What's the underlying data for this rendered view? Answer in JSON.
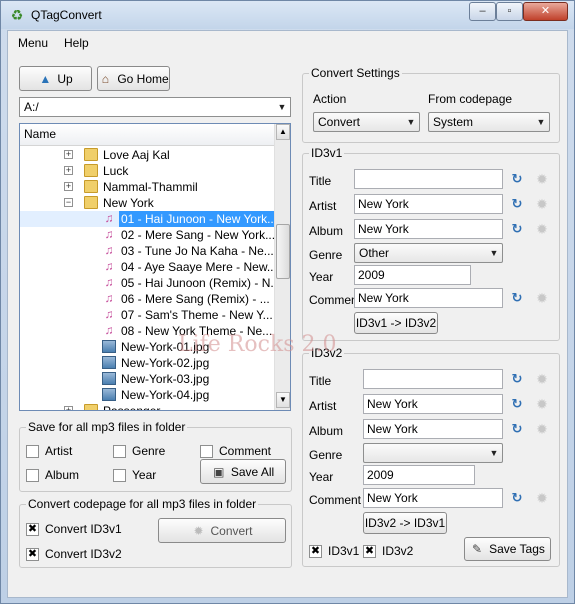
{
  "window": {
    "title": "QTagConvert",
    "min": "–",
    "max": "▫",
    "close": "✕"
  },
  "menu": [
    "Menu",
    "Help"
  ],
  "nav": {
    "up_label": "Up",
    "go_home_label": "Go Home",
    "path": "A:/"
  },
  "tree": {
    "header": "Name",
    "rows": [
      {
        "label": "Love Aaj Kal",
        "type": "folder"
      },
      {
        "label": "Luck",
        "type": "folder"
      },
      {
        "label": "Nammal-Thammil",
        "type": "folder"
      },
      {
        "label": "New York",
        "type": "folder"
      },
      {
        "label": "01 - Hai Junoon - New York...",
        "type": "music"
      },
      {
        "label": "02 - Mere Sang - New York...",
        "type": "music"
      },
      {
        "label": "03 - Tune Jo Na Kaha - Ne...",
        "type": "music"
      },
      {
        "label": "04 - Aye Saaye Mere - New...",
        "type": "music"
      },
      {
        "label": "05 - Hai Junoon (Remix) - N...",
        "type": "music"
      },
      {
        "label": "06 - Mere Sang (Remix) - ...",
        "type": "music"
      },
      {
        "label": "07 - Sam's Theme - New Y...",
        "type": "music"
      },
      {
        "label": "08 - New York Theme - Ne...",
        "type": "music"
      },
      {
        "label": "New-York-01.jpg",
        "type": "image"
      },
      {
        "label": "New-York-02.jpg",
        "type": "image"
      },
      {
        "label": "New-York-03.jpg",
        "type": "image"
      },
      {
        "label": "New-York-04.jpg",
        "type": "image"
      },
      {
        "label": "Passenger",
        "type": "folder"
      }
    ]
  },
  "save_group": {
    "title": "Save for all mp3 files in folder",
    "artist": "Artist",
    "genre": "Genre",
    "comment": "Comment",
    "album": "Album",
    "year": "Year",
    "save_all": "Save All"
  },
  "convert_group": {
    "title": "Convert codepage for all mp3 files in folder",
    "id3v1": "Convert ID3v1",
    "id3v2": "Convert ID3v2",
    "id3v1_checked": "✖",
    "id3v2_checked": "✖",
    "convert": "Convert"
  },
  "settings": {
    "title": "Convert Settings",
    "action_label": "Action",
    "action_value": "Convert",
    "codepage_label": "From codepage",
    "codepage_value": "System"
  },
  "id3v1": {
    "title": "ID3v1",
    "title_label": "Title",
    "title_value": "",
    "artist_label": "Artist",
    "artist_value": "New York",
    "album_label": "Album",
    "album_value": "New York",
    "genre_label": "Genre",
    "genre_value": "Other",
    "year_label": "Year",
    "year_value": "2009",
    "comment_label": "Comment",
    "comment_value": "New York",
    "copy_button": "ID3v1 -> ID3v2"
  },
  "id3v2": {
    "title": "ID3v2",
    "title_label": "Title",
    "title_value": "",
    "artist_label": "Artist",
    "artist_value": "New York",
    "album_label": "Album",
    "album_value": "New York",
    "genre_label": "Genre",
    "genre_value": "",
    "year_label": "Year",
    "year_value": "2009",
    "comment_label": "Comment",
    "comment_value": "New York",
    "copy_button": "ID3v2 -> ID3v1",
    "chk_v1": "ID3v1",
    "chk_v2": "ID3v2",
    "chk_v1_mark": "✖",
    "chk_v2_mark": "✖",
    "save_tags": "Save Tags"
  },
  "watermark": "Life Rocks 2.0",
  "icons": {
    "app": "recycle-icon",
    "up": "up-arrow-icon",
    "home": "home-icon",
    "refresh": "refresh-icon",
    "gear": "gear-icon",
    "save": "floppy-icon"
  }
}
